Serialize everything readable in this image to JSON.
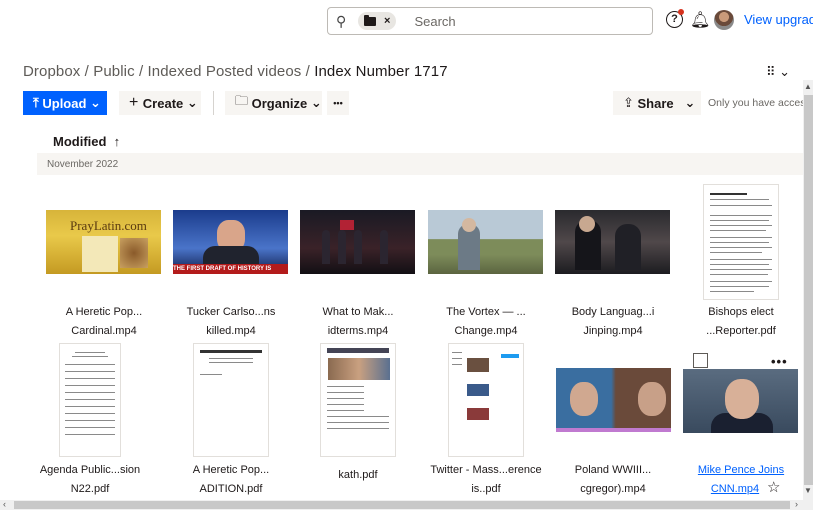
{
  "topbar": {
    "search_placeholder": "Search",
    "chip_close": "×",
    "help": "?",
    "upgrade": "View upgrade"
  },
  "breadcrumb": {
    "items": [
      "Dropbox",
      "Public",
      "Indexed Posted videos"
    ],
    "current": "Index Number 1717",
    "sep": " / "
  },
  "actions": {
    "upload": "Upload",
    "create": "Create",
    "organize": "Organize",
    "more": "•••",
    "share": "Share",
    "access": "Only you have access"
  },
  "sort": {
    "label": "Modified",
    "arrow": "↑"
  },
  "group": {
    "month": "November 2022"
  },
  "files": [
    {
      "line1": "A Heretic Pop...",
      "line2": "Cardinal.mp4"
    },
    {
      "line1": "Tucker Carlso...ns",
      "line2": "killed.mp4"
    },
    {
      "line1": "What to Mak...",
      "line2": "idterms.mp4"
    },
    {
      "line1": "The Vortex — ...",
      "line2": "Change.mp4"
    },
    {
      "line1": "Body Languag...i",
      "line2": "Jinping.mp4"
    },
    {
      "line1": "Bishops elect",
      "line2": "...Reporter.pdf"
    },
    {
      "line1": "Agenda Public...sion",
      "line2": "N22.pdf"
    },
    {
      "line1": "A Heretic Pop...",
      "line2": "ADITION.pdf"
    },
    {
      "line1": "kath.pdf",
      "line2": ""
    },
    {
      "line1": "Twitter - Mass...erence",
      "line2": "is..pdf"
    },
    {
      "line1": "Poland WWIII...",
      "line2": "cgregor).mp4"
    },
    {
      "line1": "Mike Pence Joins",
      "line2": "CNN.mp4"
    }
  ],
  "thumb_text": {
    "praylatin": "PrayLatin.com",
    "tucker_bar": "THE FIRST DRAFT OF HISTORY IS ALWAYS WRONG"
  },
  "colors": {
    "accent": "#0061fe",
    "text": "#1e1919",
    "muted": "#6b6864",
    "surface": "#f7f5f2"
  }
}
